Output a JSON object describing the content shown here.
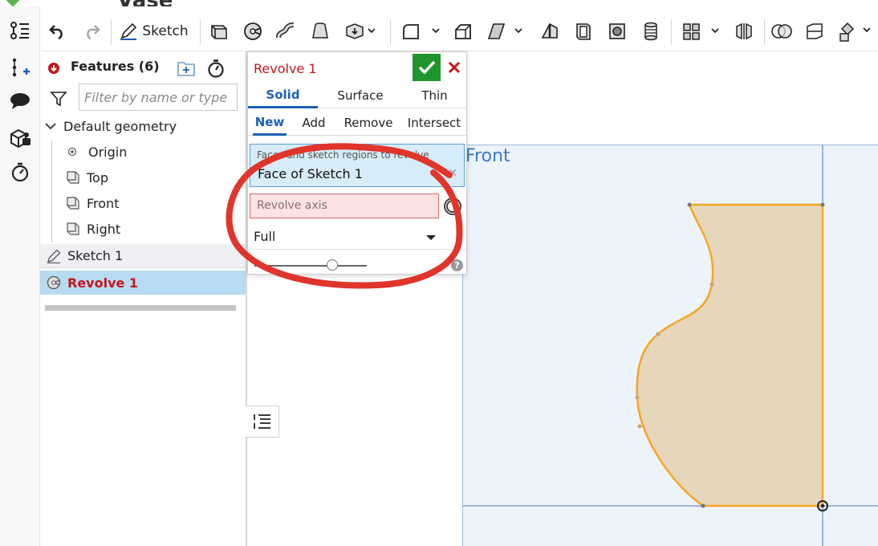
{
  "document": {
    "title": "Vase"
  },
  "toolbar": {
    "sketch_label": "Sketch",
    "icons": [
      "undo-icon",
      "redo-icon",
      "sketch-icon",
      "extrude-icon",
      "revolve-icon",
      "sweep-icon",
      "loft-icon",
      "thicken-icon",
      "fillet-icon",
      "chamfer-icon",
      "draft-icon",
      "rib-icon",
      "shell-icon",
      "hole-icon",
      "thread-icon",
      "pattern-icon",
      "mirror-icon",
      "boolean-icon",
      "split-icon",
      "transform-icon"
    ]
  },
  "rail": {
    "icons": [
      "feature-tree-icon",
      "insert-icon",
      "comment-icon",
      "parts-icon",
      "history-icon"
    ]
  },
  "features_panel": {
    "title": "Features (6)",
    "filter_placeholder": "Filter by name or type",
    "default_geometry_label": "Default geometry",
    "items": [
      {
        "label": "Origin",
        "icon": "origin-icon"
      },
      {
        "label": "Top",
        "icon": "plane-icon"
      },
      {
        "label": "Front",
        "icon": "plane-icon"
      },
      {
        "label": "Right",
        "icon": "plane-icon"
      },
      {
        "label": "Sketch 1",
        "icon": "sketch-icon"
      },
      {
        "label": "Revolve 1",
        "icon": "revolve-icon"
      }
    ]
  },
  "viewport": {
    "plane_label": "Front"
  },
  "revolve_dialog": {
    "title": "Revolve 1",
    "body_tabs": [
      "Solid",
      "Surface",
      "Thin"
    ],
    "active_body_tab": "Solid",
    "op_tabs": [
      "New",
      "Add",
      "Remove",
      "Intersect"
    ],
    "active_op_tab": "New",
    "faces_hint": "Faces and sketch regions to revolve",
    "faces_value": "Face of Sketch 1",
    "axis_placeholder": "Revolve axis",
    "revolve_type": "Full",
    "help": "?"
  },
  "colors": {
    "accent": "#1f5fb3",
    "error": "#c4161c",
    "ok": "#20952e",
    "sketch_edge": "#f5a623",
    "sketch_fill": "#e6d6bb",
    "plane": "#9ab9dc",
    "annotation": "#e0352b"
  }
}
